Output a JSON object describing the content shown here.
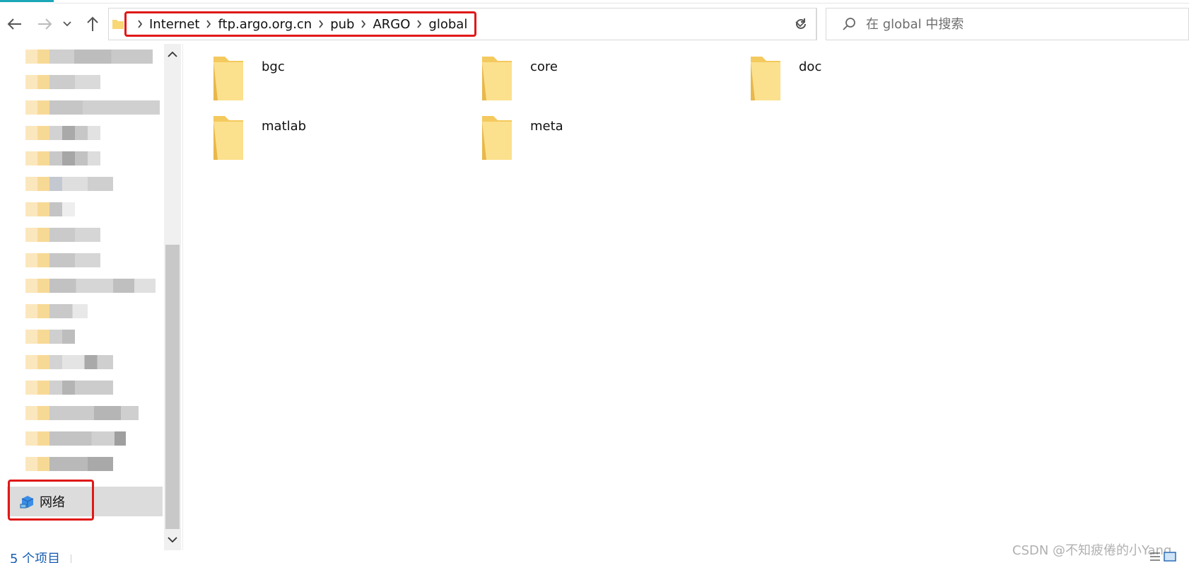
{
  "address_bar": {
    "path": [
      "Internet",
      "ftp.argo.org.cn",
      "pub",
      "ARGO",
      "global"
    ]
  },
  "search": {
    "placeholder": "在 global 中搜索"
  },
  "nav_pane": {
    "network_label": "网络"
  },
  "files": {
    "items": [
      {
        "name": "bgc"
      },
      {
        "name": "core"
      },
      {
        "name": "doc"
      },
      {
        "name": "matlab"
      },
      {
        "name": "meta"
      }
    ]
  },
  "status_bar": {
    "item_count": "5 个项目"
  },
  "watermark": "CSDN @不知疲倦的小Yang",
  "colors": {
    "highlight_red": "#e01818",
    "accent_teal": "#1aa7b8",
    "folder_yellow": "#f8d775"
  }
}
